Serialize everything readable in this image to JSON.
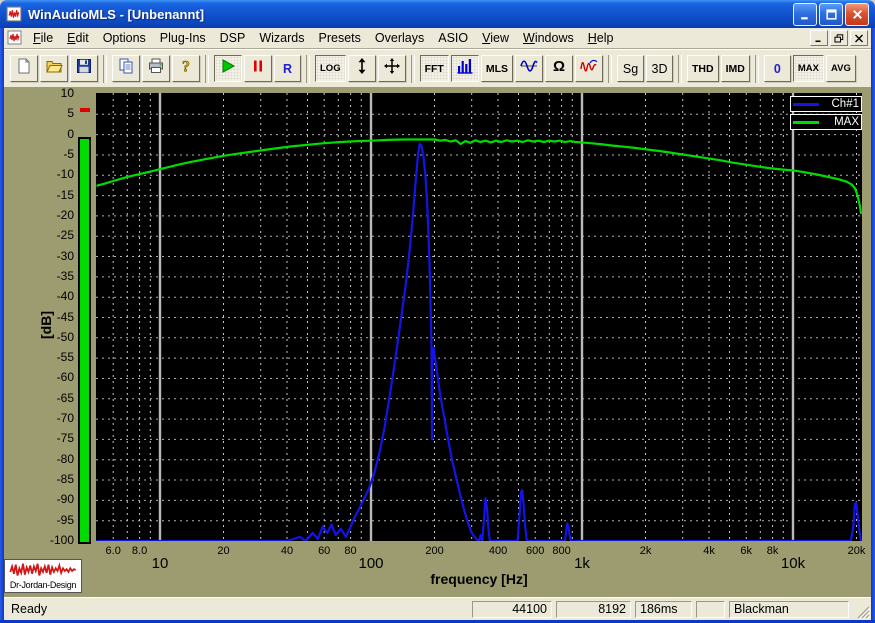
{
  "window": {
    "title": "WinAudioMLS - [Unbenannt]"
  },
  "menu": {
    "items": [
      {
        "label": "File",
        "u": 0
      },
      {
        "label": "Edit",
        "u": 0
      },
      {
        "label": "Options"
      },
      {
        "label": "Plug-Ins"
      },
      {
        "label": "DSP"
      },
      {
        "label": "Wizards"
      },
      {
        "label": "Presets"
      },
      {
        "label": "Overlays"
      },
      {
        "label": "ASIO"
      },
      {
        "label": "View",
        "u": 0
      },
      {
        "label": "Windows",
        "u": 0
      },
      {
        "label": "Help",
        "u": 0
      }
    ]
  },
  "toolbar": {
    "groups": [
      [
        {
          "name": "new",
          "icon": "new-file"
        },
        {
          "name": "open",
          "icon": "open-folder"
        },
        {
          "name": "save",
          "icon": "save-floppy"
        }
      ],
      [
        {
          "name": "copy",
          "icon": "copy"
        },
        {
          "name": "print",
          "icon": "printer"
        },
        {
          "name": "help",
          "icon": "help"
        }
      ],
      [
        {
          "name": "play",
          "icon": "play",
          "active": true
        },
        {
          "name": "pause",
          "icon": "pause"
        },
        {
          "name": "record",
          "label": "R",
          "style": "letter-blue"
        }
      ],
      [
        {
          "name": "log-scale",
          "label": "LOG",
          "style": "small-bold",
          "active": true
        },
        {
          "name": "vertical-scale",
          "icon": "vertical-arrows"
        },
        {
          "name": "pan",
          "icon": "move-arrows"
        }
      ],
      [
        {
          "name": "fft",
          "label": "FFT",
          "style": "bold",
          "active": true
        },
        {
          "name": "spectrum",
          "icon": "spectrum-bars",
          "active": true
        },
        {
          "name": "mls",
          "label": "MLS",
          "style": "bold"
        },
        {
          "name": "oscilloscope",
          "icon": "sine-wave"
        },
        {
          "name": "impedance",
          "icon": "omega"
        },
        {
          "name": "impulse-response",
          "icon": "impulse"
        }
      ],
      [
        {
          "name": "signal-generator",
          "label": "Sg",
          "style": "plain"
        },
        {
          "name": "view-3d",
          "label": "3D",
          "style": "plain"
        }
      ],
      [
        {
          "name": "thd",
          "label": "THD",
          "style": "bold"
        },
        {
          "name": "imd",
          "label": "IMD",
          "style": "bold"
        }
      ],
      [
        {
          "name": "reset",
          "label": "0",
          "style": "letter-blue"
        },
        {
          "name": "max-hold",
          "label": "MAX",
          "style": "small-bold",
          "active": true
        },
        {
          "name": "average",
          "label": "AVG",
          "style": "small-bold"
        }
      ]
    ]
  },
  "chart_data": {
    "type": "line",
    "x_scale": "log",
    "x_axis_label": "frequency [Hz]",
    "y_axis_label": "[dB]",
    "x_range_hz": [
      5,
      21000
    ],
    "y_range_db": [
      -100,
      10
    ],
    "y_tick_step_db": 5,
    "grid": "both",
    "legend_position": "top-right",
    "x_decade_ticks": [
      {
        "label": "10",
        "hz": 10
      },
      {
        "label": "100",
        "hz": 100
      },
      {
        "label": "1k",
        "hz": 1000
      },
      {
        "label": "10k",
        "hz": 10000
      }
    ],
    "x_minor_ticks": [
      {
        "label": "6.0",
        "hz": 6
      },
      {
        "label": "8.0",
        "hz": 8
      },
      {
        "label": "20",
        "hz": 20
      },
      {
        "label": "40",
        "hz": 40
      },
      {
        "label": "60",
        "hz": 60
      },
      {
        "label": "80",
        "hz": 80
      },
      {
        "label": "200",
        "hz": 200
      },
      {
        "label": "400",
        "hz": 400
      },
      {
        "label": "600",
        "hz": 600
      },
      {
        "label": "800",
        "hz": 800
      },
      {
        "label": "2k",
        "hz": 2000
      },
      {
        "label": "4k",
        "hz": 4000
      },
      {
        "label": "6k",
        "hz": 6000
      },
      {
        "label": "8k",
        "hz": 8000
      },
      {
        "label": "20k",
        "hz": 20000
      }
    ],
    "series": [
      {
        "name": "Ch#1",
        "color": "#1414e6",
        "points": [
          [
            5,
            -100
          ],
          [
            40,
            -100
          ],
          [
            46,
            -99
          ],
          [
            49,
            -100
          ],
          [
            53,
            -98
          ],
          [
            56,
            -99.5
          ],
          [
            59,
            -96.5
          ],
          [
            62,
            -98
          ],
          [
            65,
            -96
          ],
          [
            68,
            -98.5
          ],
          [
            72,
            -97
          ],
          [
            76,
            -99
          ],
          [
            80,
            -96.5
          ],
          [
            84,
            -94
          ],
          [
            88,
            -92
          ],
          [
            93,
            -89.5
          ],
          [
            98,
            -87
          ],
          [
            104,
            -83
          ],
          [
            110,
            -78
          ],
          [
            116,
            -72
          ],
          [
            122,
            -65
          ],
          [
            128,
            -58
          ],
          [
            134,
            -51
          ],
          [
            140,
            -44
          ],
          [
            146,
            -37
          ],
          [
            152,
            -29
          ],
          [
            158,
            -20
          ],
          [
            163,
            -11
          ],
          [
            167,
            -5
          ],
          [
            170,
            -2.3
          ],
          [
            173,
            -2.6
          ],
          [
            177,
            -5
          ],
          [
            181,
            -10
          ],
          [
            185,
            -18
          ],
          [
            189,
            -30
          ],
          [
            192,
            -44
          ],
          [
            193.5,
            -52
          ],
          [
            194.5,
            -75
          ],
          [
            195.5,
            -56
          ],
          [
            198,
            -52.5
          ],
          [
            201,
            -55
          ],
          [
            205,
            -58
          ],
          [
            210,
            -62
          ],
          [
            216,
            -66
          ],
          [
            223,
            -70
          ],
          [
            232,
            -75
          ],
          [
            242,
            -80
          ],
          [
            252,
            -84
          ],
          [
            263,
            -88
          ],
          [
            275,
            -92
          ],
          [
            288,
            -95.5
          ],
          [
            300,
            -98
          ],
          [
            315,
            -99.5
          ],
          [
            325,
            -100
          ],
          [
            331,
            -98.5
          ],
          [
            337,
            -100
          ],
          [
            344,
            -94
          ],
          [
            349,
            -89.5
          ],
          [
            355,
            -92
          ],
          [
            360,
            -97
          ],
          [
            366,
            -100
          ],
          [
            495,
            -100
          ],
          [
            505,
            -94
          ],
          [
            514,
            -88
          ],
          [
            521,
            -87.5
          ],
          [
            529,
            -91
          ],
          [
            538,
            -96.5
          ],
          [
            548,
            -100
          ],
          [
            830,
            -100
          ],
          [
            842,
            -97.5
          ],
          [
            852,
            -95.7
          ],
          [
            862,
            -96.5
          ],
          [
            873,
            -98.5
          ],
          [
            885,
            -100
          ],
          [
            18800,
            -100
          ],
          [
            19300,
            -96.5
          ],
          [
            19650,
            -91
          ],
          [
            19900,
            -90.5
          ],
          [
            20200,
            -93
          ],
          [
            20600,
            -97
          ],
          [
            21000,
            -100
          ]
        ]
      },
      {
        "name": "MAX",
        "color": "#00dc00",
        "points": [
          [
            5,
            -12.6
          ],
          [
            5.5,
            -12
          ],
          [
            6,
            -11.4
          ],
          [
            7,
            -10.4
          ],
          [
            8,
            -9.7
          ],
          [
            9,
            -9.1
          ],
          [
            10,
            -8.5
          ],
          [
            12,
            -7.5
          ],
          [
            14,
            -6.7
          ],
          [
            17,
            -5.9
          ],
          [
            20,
            -5.2
          ],
          [
            24,
            -4.6
          ],
          [
            29,
            -4
          ],
          [
            35,
            -3.4
          ],
          [
            42,
            -2.9
          ],
          [
            50,
            -2.5
          ],
          [
            60,
            -2.1
          ],
          [
            72,
            -1.8
          ],
          [
            86,
            -1.6
          ],
          [
            100,
            -1.5
          ],
          [
            120,
            -1.3
          ],
          [
            145,
            -1.2
          ],
          [
            175,
            -1.2
          ],
          [
            200,
            -1.2
          ],
          [
            213,
            -1.5
          ],
          [
            225,
            -1.3
          ],
          [
            238,
            -1.7
          ],
          [
            252,
            -1.4
          ],
          [
            266,
            -2.3
          ],
          [
            280,
            -1.6
          ],
          [
            296,
            -2
          ],
          [
            312,
            -1.4
          ],
          [
            330,
            -1.8
          ],
          [
            350,
            -1.5
          ],
          [
            370,
            -1.9
          ],
          [
            392,
            -1.5
          ],
          [
            415,
            -1.8
          ],
          [
            440,
            -1.4
          ],
          [
            466,
            -1.7
          ],
          [
            494,
            -1.5
          ],
          [
            523,
            -1.8
          ],
          [
            554,
            -1.4
          ],
          [
            587,
            -1.7
          ],
          [
            622,
            -1.5
          ],
          [
            659,
            -1.8
          ],
          [
            698,
            -1.5
          ],
          [
            740,
            -1.7
          ],
          [
            784,
            -1.5
          ],
          [
            830,
            -1.8
          ],
          [
            880,
            -1.6
          ],
          [
            932,
            -1.8
          ],
          [
            988,
            -1.9
          ],
          [
            1100,
            -2.1
          ],
          [
            1250,
            -2.4
          ],
          [
            1400,
            -2.7
          ],
          [
            1600,
            -3
          ],
          [
            1800,
            -3.3
          ],
          [
            2000,
            -3.6
          ],
          [
            2300,
            -4
          ],
          [
            2600,
            -4.4
          ],
          [
            3000,
            -4.9
          ],
          [
            3400,
            -5.3
          ],
          [
            3900,
            -5.8
          ],
          [
            4500,
            -6.3
          ],
          [
            5200,
            -6.9
          ],
          [
            6000,
            -7.4
          ],
          [
            6900,
            -7.9
          ],
          [
            7900,
            -8.3
          ],
          [
            9000,
            -8.6
          ],
          [
            10000,
            -8.8
          ],
          [
            11500,
            -9.3
          ],
          [
            13000,
            -9.8
          ],
          [
            14700,
            -10.4
          ],
          [
            16500,
            -11
          ],
          [
            18000,
            -11.6
          ],
          [
            19000,
            -12.3
          ],
          [
            19600,
            -13.1
          ],
          [
            20000,
            -14.2
          ],
          [
            20400,
            -15.8
          ],
          [
            20800,
            -17.8
          ],
          [
            21000,
            -19.5
          ]
        ]
      }
    ],
    "level_meter": {
      "color": "#00dc00",
      "top_db": -1.4,
      "bottom_db": -100,
      "peak_db": 6,
      "peak_color": "#dd0000"
    }
  },
  "statusbar": {
    "message": "Ready",
    "fields": [
      {
        "name": "sample-rate",
        "value": "44100"
      },
      {
        "name": "fft-size",
        "value": "8192"
      },
      {
        "name": "time",
        "value": "186ms"
      },
      {
        "name": "spare",
        "value": ""
      },
      {
        "name": "window-function",
        "value": "Blackman"
      }
    ]
  },
  "logo": {
    "text": "Dr-Jordan-Design"
  }
}
